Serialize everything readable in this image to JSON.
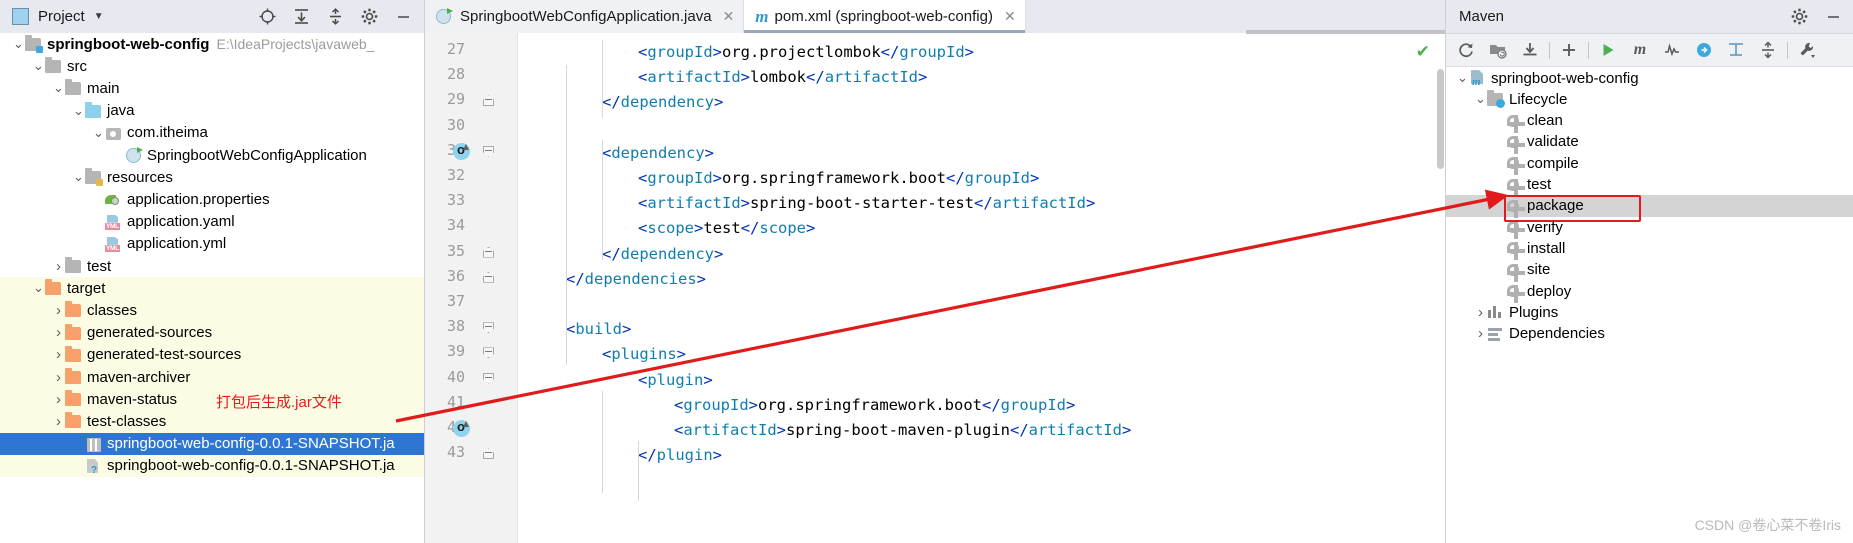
{
  "project_panel": {
    "header": {
      "title": "Project",
      "caret": "▼",
      "icons": [
        "locate-icon",
        "expand-all-icon",
        "collapse-all-icon",
        "settings-gear-icon",
        "minimize-icon"
      ]
    },
    "tree": [
      {
        "depth": 0,
        "arrow": "v",
        "icon": "module-folder",
        "label": "springboot-web-config",
        "sub": "E:\\IdeaProjects\\javaweb_",
        "bold": true,
        "selected": false,
        "yellow": false
      },
      {
        "depth": 1,
        "arrow": "v",
        "icon": "folder-gray",
        "label": "src",
        "sub": "",
        "bold": false,
        "selected": false,
        "yellow": false
      },
      {
        "depth": 2,
        "arrow": "v",
        "icon": "folder-gray",
        "label": "main",
        "sub": "",
        "bold": false,
        "selected": false,
        "yellow": false
      },
      {
        "depth": 3,
        "arrow": "v",
        "icon": "folder-blue",
        "label": "java",
        "sub": "",
        "bold": false,
        "selected": false,
        "yellow": false
      },
      {
        "depth": 4,
        "arrow": "v",
        "icon": "package-icon",
        "label": "com.itheima",
        "sub": "",
        "bold": false,
        "selected": false,
        "yellow": false
      },
      {
        "depth": 5,
        "arrow": "",
        "icon": "spring-class-icon",
        "label": "SpringbootWebConfigApplication",
        "sub": "",
        "bold": false,
        "selected": false,
        "yellow": false
      },
      {
        "depth": 3,
        "arrow": "v",
        "icon": "resources-folder",
        "label": "resources",
        "sub": "",
        "bold": false,
        "selected": false,
        "yellow": false
      },
      {
        "depth": 4,
        "arrow": "",
        "icon": "properties-icon",
        "label": "application.properties",
        "sub": "",
        "bold": false,
        "selected": false,
        "yellow": false
      },
      {
        "depth": 4,
        "arrow": "",
        "icon": "yml-icon",
        "label": "application.yaml",
        "sub": "",
        "bold": false,
        "selected": false,
        "yellow": false
      },
      {
        "depth": 4,
        "arrow": "",
        "icon": "yml-icon",
        "label": "application.yml",
        "sub": "",
        "bold": false,
        "selected": false,
        "yellow": false
      },
      {
        "depth": 2,
        "arrow": ">",
        "icon": "folder-gray",
        "label": "test",
        "sub": "",
        "bold": false,
        "selected": false,
        "yellow": false
      },
      {
        "depth": 1,
        "arrow": "v",
        "icon": "folder-orange",
        "label": "target",
        "sub": "",
        "bold": false,
        "selected": false,
        "yellow": true
      },
      {
        "depth": 2,
        "arrow": ">",
        "icon": "folder-orange",
        "label": "classes",
        "sub": "",
        "bold": false,
        "selected": false,
        "yellow": true
      },
      {
        "depth": 2,
        "arrow": ">",
        "icon": "folder-orange",
        "label": "generated-sources",
        "sub": "",
        "bold": false,
        "selected": false,
        "yellow": true
      },
      {
        "depth": 2,
        "arrow": ">",
        "icon": "folder-orange",
        "label": "generated-test-sources",
        "sub": "",
        "bold": false,
        "selected": false,
        "yellow": true
      },
      {
        "depth": 2,
        "arrow": ">",
        "icon": "folder-orange",
        "label": "maven-archiver",
        "sub": "",
        "bold": false,
        "selected": false,
        "yellow": true
      },
      {
        "depth": 2,
        "arrow": ">",
        "icon": "folder-orange",
        "label": "maven-status",
        "sub": "",
        "bold": false,
        "selected": false,
        "yellow": true
      },
      {
        "depth": 2,
        "arrow": ">",
        "icon": "folder-orange",
        "label": "test-classes",
        "sub": "",
        "bold": false,
        "selected": false,
        "yellow": true
      },
      {
        "depth": 3,
        "arrow": "",
        "icon": "jar-icon",
        "label": "springboot-web-config-0.0.1-SNAPSHOT.ja",
        "sub": "",
        "bold": false,
        "selected": true,
        "yellow": false
      },
      {
        "depth": 3,
        "arrow": "",
        "icon": "unknown-file-icon",
        "label": "springboot-web-config-0.0.1-SNAPSHOT.ja",
        "sub": "",
        "bold": false,
        "selected": false,
        "yellow": true
      }
    ],
    "annotation": "打包后生成.jar文件"
  },
  "editor": {
    "tabs": [
      {
        "label": "SpringbootWebConfigApplication.java",
        "icon": "spring-class-icon",
        "active": false,
        "close": "✕"
      },
      {
        "label": "pom.xml (springboot-web-config)",
        "icon": "maven-m-icon",
        "active": true,
        "close": "✕"
      }
    ],
    "inspection_status": "✔",
    "lines": [
      {
        "num": "27",
        "fold": "",
        "run": false,
        "indent": 3,
        "segments": [
          {
            "t": "<",
            "c": "tg"
          },
          {
            "t": "groupId",
            "c": "tg"
          },
          {
            "t": ">",
            "c": "tg"
          },
          {
            "t": "org.projectlombok",
            "c": ""
          },
          {
            "t": "</",
            "c": "tg"
          },
          {
            "t": "groupId",
            "c": "tg"
          },
          {
            "t": ">",
            "c": "tg"
          }
        ]
      },
      {
        "num": "28",
        "fold": "",
        "run": false,
        "indent": 3,
        "segments": [
          {
            "t": "<",
            "c": "tg"
          },
          {
            "t": "artifactId",
            "c": "tg"
          },
          {
            "t": ">",
            "c": "tg"
          },
          {
            "t": "lombok",
            "c": ""
          },
          {
            "t": "</",
            "c": "tg"
          },
          {
            "t": "artifactId",
            "c": "tg"
          },
          {
            "t": ">",
            "c": "tg"
          }
        ]
      },
      {
        "num": "29",
        "fold": "close",
        "run": false,
        "indent": 2,
        "segments": [
          {
            "t": "</",
            "c": "tg"
          },
          {
            "t": "dependency",
            "c": "tg"
          },
          {
            "t": ">",
            "c": "tg"
          }
        ]
      },
      {
        "num": "30",
        "fold": "",
        "run": false,
        "indent": 0,
        "segments": []
      },
      {
        "num": "31",
        "fold": "open",
        "run": true,
        "indent": 2,
        "segments": [
          {
            "t": "<",
            "c": "tg"
          },
          {
            "t": "dependency",
            "c": "tg"
          },
          {
            "t": ">",
            "c": "tg"
          }
        ]
      },
      {
        "num": "32",
        "fold": "",
        "run": false,
        "indent": 3,
        "segments": [
          {
            "t": "<",
            "c": "tg"
          },
          {
            "t": "groupId",
            "c": "tg"
          },
          {
            "t": ">",
            "c": "tg"
          },
          {
            "t": "org.springframework.boot",
            "c": ""
          },
          {
            "t": "</",
            "c": "tg"
          },
          {
            "t": "groupId",
            "c": "tg"
          },
          {
            "t": ">",
            "c": "tg"
          }
        ]
      },
      {
        "num": "33",
        "fold": "",
        "run": false,
        "indent": 3,
        "segments": [
          {
            "t": "<",
            "c": "tg"
          },
          {
            "t": "artifactId",
            "c": "tg"
          },
          {
            "t": ">",
            "c": "tg"
          },
          {
            "t": "spring-boot-starter-test",
            "c": ""
          },
          {
            "t": "</",
            "c": "tg"
          },
          {
            "t": "artifactId",
            "c": "tg"
          },
          {
            "t": ">",
            "c": "tg"
          }
        ]
      },
      {
        "num": "34",
        "fold": "",
        "run": false,
        "indent": 3,
        "segments": [
          {
            "t": "<",
            "c": "tg"
          },
          {
            "t": "scope",
            "c": "tg"
          },
          {
            "t": ">",
            "c": "tg"
          },
          {
            "t": "test",
            "c": ""
          },
          {
            "t": "</",
            "c": "tg"
          },
          {
            "t": "scope",
            "c": "tg"
          },
          {
            "t": ">",
            "c": "tg"
          }
        ]
      },
      {
        "num": "35",
        "fold": "close",
        "run": false,
        "indent": 2,
        "segments": [
          {
            "t": "</",
            "c": "tg"
          },
          {
            "t": "dependency",
            "c": "tg"
          },
          {
            "t": ">",
            "c": "tg"
          }
        ]
      },
      {
        "num": "36",
        "fold": "close",
        "run": false,
        "indent": 1,
        "segments": [
          {
            "t": "</",
            "c": "tg"
          },
          {
            "t": "dependencies",
            "c": "tg"
          },
          {
            "t": ">",
            "c": "tg"
          }
        ]
      },
      {
        "num": "37",
        "fold": "",
        "run": false,
        "indent": 0,
        "segments": []
      },
      {
        "num": "38",
        "fold": "open",
        "run": false,
        "indent": 1,
        "segments": [
          {
            "t": "<",
            "c": "tg"
          },
          {
            "t": "build",
            "c": "tg"
          },
          {
            "t": ">",
            "c": "tg"
          }
        ]
      },
      {
        "num": "39",
        "fold": "open",
        "run": false,
        "indent": 2,
        "segments": [
          {
            "t": "<",
            "c": "tg"
          },
          {
            "t": "plugins",
            "c": "tg"
          },
          {
            "t": ">",
            "c": "tg"
          }
        ]
      },
      {
        "num": "40",
        "fold": "open",
        "run": false,
        "indent": 3,
        "segments": [
          {
            "t": "<",
            "c": "tg"
          },
          {
            "t": "plugin",
            "c": "tg"
          },
          {
            "t": ">",
            "c": "tg"
          }
        ]
      },
      {
        "num": "41",
        "fold": "",
        "run": false,
        "indent": 4,
        "segments": [
          {
            "t": "<",
            "c": "tg"
          },
          {
            "t": "groupId",
            "c": "tg"
          },
          {
            "t": ">",
            "c": "tg"
          },
          {
            "t": "org.springframework.boot",
            "c": ""
          },
          {
            "t": "</",
            "c": "tg"
          },
          {
            "t": "groupId",
            "c": "tg"
          },
          {
            "t": ">",
            "c": "tg"
          }
        ]
      },
      {
        "num": "42",
        "fold": "",
        "run": true,
        "indent": 4,
        "segments": [
          {
            "t": "<",
            "c": "tg"
          },
          {
            "t": "artifactId",
            "c": "tg"
          },
          {
            "t": ">",
            "c": "tg"
          },
          {
            "t": "spring-boot-maven-plugin",
            "c": ""
          },
          {
            "t": "</",
            "c": "tg"
          },
          {
            "t": "artifactId",
            "c": "tg"
          },
          {
            "t": ">",
            "c": "tg"
          }
        ]
      },
      {
        "num": "43",
        "fold": "close",
        "run": false,
        "indent": 3,
        "segments": [
          {
            "t": "</",
            "c": "tg"
          },
          {
            "t": "plugin",
            "c": "tg"
          },
          {
            "t": ">",
            "c": "tg"
          }
        ]
      }
    ]
  },
  "maven_panel": {
    "title": "Maven",
    "header_icons": [
      "settings-gear-icon",
      "minimize-icon"
    ],
    "toolbar_icons": [
      "reload-icon",
      "add-maven-project-icon",
      "download-sources-icon",
      "plus-icon",
      "run-icon",
      "maven-m-icon",
      "toggle-skip-tests-icon",
      "execute-goal-icon",
      "show-dependencies-icon",
      "collapse-all-icon",
      "settings-wrench-icon"
    ],
    "tree": [
      {
        "depth": 0,
        "arrow": "v",
        "icon": "maven-project-icon",
        "label": "springboot-web-config",
        "selected": false,
        "boxed": false
      },
      {
        "depth": 1,
        "arrow": "v",
        "icon": "lifecycle-folder-icon",
        "label": "Lifecycle",
        "selected": false,
        "boxed": false
      },
      {
        "depth": 2,
        "arrow": "",
        "icon": "gear-icon",
        "label": "clean",
        "selected": false,
        "boxed": false
      },
      {
        "depth": 2,
        "arrow": "",
        "icon": "gear-icon",
        "label": "validate",
        "selected": false,
        "boxed": false
      },
      {
        "depth": 2,
        "arrow": "",
        "icon": "gear-icon",
        "label": "compile",
        "selected": false,
        "boxed": false
      },
      {
        "depth": 2,
        "arrow": "",
        "icon": "gear-icon",
        "label": "test",
        "selected": false,
        "boxed": false
      },
      {
        "depth": 2,
        "arrow": "",
        "icon": "gear-icon",
        "label": "package",
        "selected": true,
        "boxed": true
      },
      {
        "depth": 2,
        "arrow": "",
        "icon": "gear-icon",
        "label": "verify",
        "selected": false,
        "boxed": false
      },
      {
        "depth": 2,
        "arrow": "",
        "icon": "gear-icon",
        "label": "install",
        "selected": false,
        "boxed": false
      },
      {
        "depth": 2,
        "arrow": "",
        "icon": "gear-icon",
        "label": "site",
        "selected": false,
        "boxed": false
      },
      {
        "depth": 2,
        "arrow": "",
        "icon": "gear-icon",
        "label": "deploy",
        "selected": false,
        "boxed": false
      },
      {
        "depth": 1,
        "arrow": ">",
        "icon": "plugins-icon",
        "label": "Plugins",
        "selected": false,
        "boxed": false
      },
      {
        "depth": 1,
        "arrow": ">",
        "icon": "dependencies-icon",
        "label": "Dependencies",
        "selected": false,
        "boxed": false
      }
    ]
  },
  "watermark": "CSDN @卷心菜不卷Iris",
  "colors": {
    "accent_red": "#e01b1b",
    "selection_blue": "#2f76d2",
    "target_yellow": "#fcfbe4",
    "tag_blue": "#0033b3",
    "tagname_blue": "#0f7eaf"
  }
}
